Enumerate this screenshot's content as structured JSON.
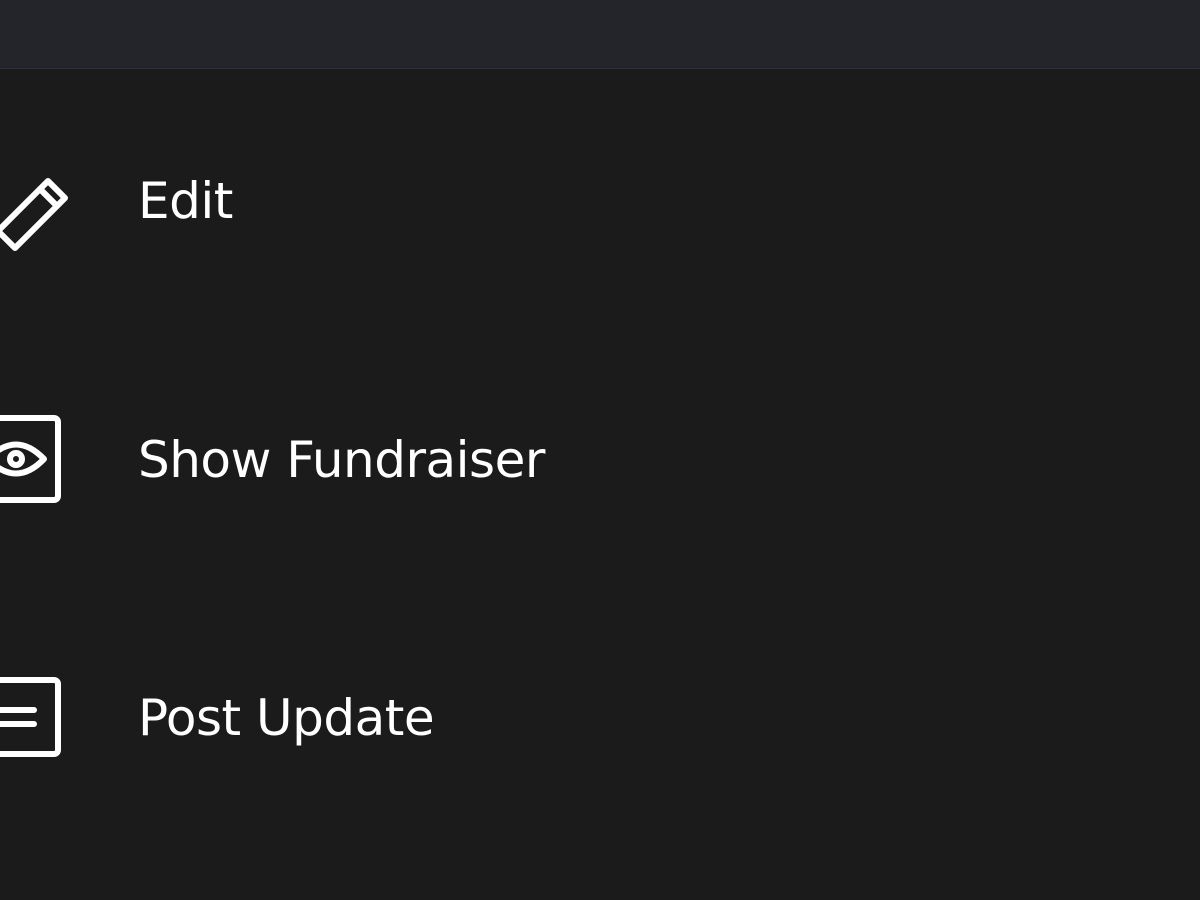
{
  "colors": {
    "background": "#1b1b1b",
    "top_bar": "#23252b",
    "text": "#ffffff"
  },
  "menu": {
    "items": [
      {
        "label": "Edit",
        "icon": "pencil-icon"
      },
      {
        "label": "Show Fundraiser",
        "icon": "eye-icon"
      },
      {
        "label": "Post Update",
        "icon": "text-lines-icon"
      }
    ]
  }
}
